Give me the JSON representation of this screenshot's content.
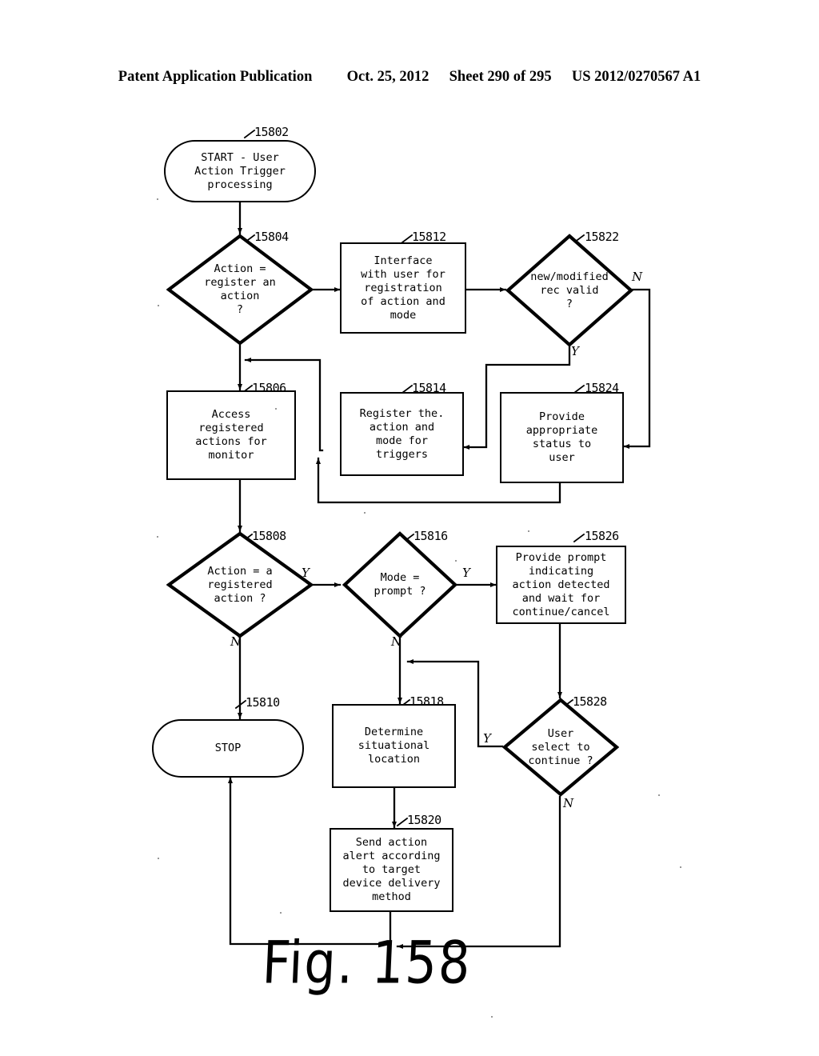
{
  "header": {
    "publication": "Patent Application Publication",
    "date": "Oct. 25, 2012",
    "sheet": "Sheet 290 of 295",
    "patent_number": "US 2012/0270567 A1"
  },
  "figure": {
    "caption": "Fig. 158",
    "title": "User Action Trigger processing flowchart"
  },
  "nodes": [
    {
      "id": "15802",
      "ref": "15802",
      "shape": "terminal",
      "text": "START - User\nAction Trigger\nprocessing"
    },
    {
      "id": "15804",
      "ref": "15804",
      "shape": "diamond",
      "text": "Action =\nregister an\naction\n?"
    },
    {
      "id": "15812",
      "ref": "15812",
      "shape": "box",
      "text": "Interface\nwith user for\nregistration\nof action and\nmode"
    },
    {
      "id": "15822",
      "ref": "15822",
      "shape": "diamond",
      "text": "new/modified\nrec valid\n?"
    },
    {
      "id": "15806",
      "ref": "15806",
      "shape": "box",
      "text": "Access\nregistered\nactions for\nmonitor"
    },
    {
      "id": "15814",
      "ref": "15814",
      "shape": "box",
      "text": "Register the.\naction and\nmode for\ntriggers"
    },
    {
      "id": "15824",
      "ref": "15824",
      "shape": "box",
      "text": "Provide\nappropriate\nstatus to\nuser"
    },
    {
      "id": "15808",
      "ref": "15808",
      "shape": "diamond",
      "text": "Action = a\nregistered\naction ?"
    },
    {
      "id": "15816",
      "ref": "15816",
      "shape": "diamond",
      "text": "Mode =\nprompt ?"
    },
    {
      "id": "15826",
      "ref": "15826",
      "shape": "box",
      "text": "Provide prompt\nindicating\naction detected\nand wait for\ncontinue/cancel"
    },
    {
      "id": "15810",
      "ref": "15810",
      "shape": "terminal",
      "text": "STOP"
    },
    {
      "id": "15818",
      "ref": "15818",
      "shape": "box",
      "text": "Determine\nsituational\nlocation"
    },
    {
      "id": "15828",
      "ref": "15828",
      "shape": "diamond",
      "text": "User\nselect to\ncontinue ?"
    },
    {
      "id": "15820",
      "ref": "15820",
      "shape": "box",
      "text": "Send action\nalert according\nto target\ndevice delivery\nmethod"
    }
  ],
  "branch_labels": [
    {
      "id": "b15822n",
      "text": "N",
      "of": "15822"
    },
    {
      "id": "b15822y",
      "text": "Y",
      "of": "15822"
    },
    {
      "id": "b15808y",
      "text": "Y",
      "of": "15808"
    },
    {
      "id": "b15808n",
      "text": "N",
      "of": "15808"
    },
    {
      "id": "b15816y",
      "text": "Y",
      "of": "15816"
    },
    {
      "id": "b15816n",
      "text": "N",
      "of": "15816"
    },
    {
      "id": "b15828y",
      "text": "Y",
      "of": "15828"
    },
    {
      "id": "b15828n",
      "text": "N",
      "of": "15828"
    }
  ],
  "colors": {
    "ink": "#000000",
    "paper": "#ffffff"
  }
}
